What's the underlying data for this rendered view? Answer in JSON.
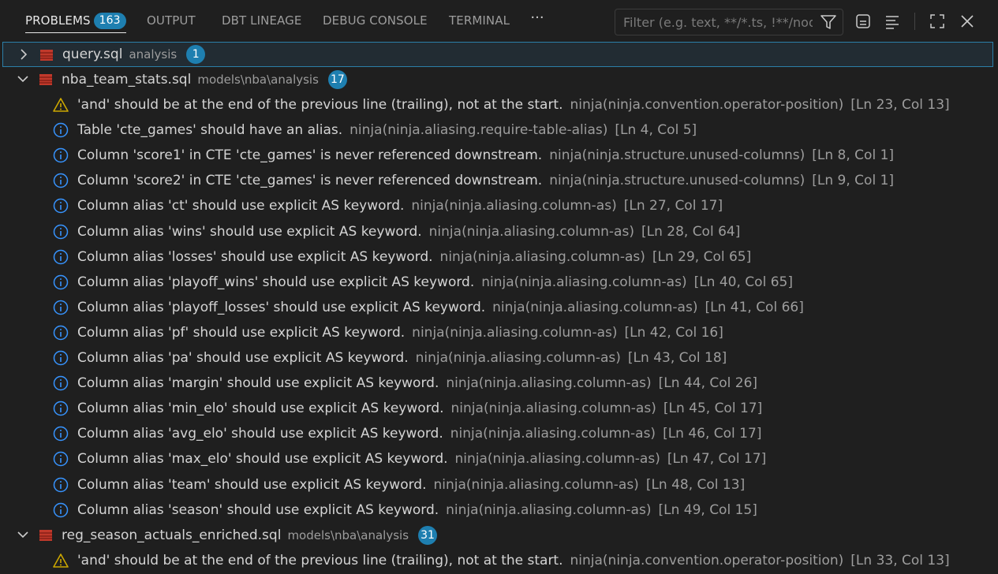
{
  "tabs": [
    {
      "label": "PROBLEMS",
      "badge": "163"
    },
    {
      "label": "OUTPUT"
    },
    {
      "label": "DBT LINEAGE"
    },
    {
      "label": "DEBUG CONSOLE"
    },
    {
      "label": "TERMINAL"
    }
  ],
  "more_label": "···",
  "filter": {
    "placeholder": "Filter (e.g. text, **/*.ts, !**/nod..."
  },
  "files": [
    {
      "name": "query.sql",
      "path": "analysis",
      "count": "1",
      "expanded": false
    },
    {
      "name": "nba_team_stats.sql",
      "path": "models\\nba\\analysis",
      "count": "17",
      "expanded": true
    },
    {
      "name": "reg_season_actuals_enriched.sql",
      "path": "models\\nba\\analysis",
      "count": "31",
      "expanded": true
    }
  ],
  "problems": [
    {
      "severity": "warning",
      "message": "'and' should be at the end of the previous line (trailing), not at the start.",
      "source": "ninja(ninja.convention.operator-position)",
      "location": "[Ln 23, Col 13]"
    },
    {
      "severity": "info",
      "message": "Table 'cte_games' should have an alias.",
      "source": "ninja(ninja.aliasing.require-table-alias)",
      "location": "[Ln 4, Col 5]"
    },
    {
      "severity": "info",
      "message": "Column 'score1' in CTE 'cte_games' is never referenced downstream.",
      "source": "ninja(ninja.structure.unused-columns)",
      "location": "[Ln 8, Col 1]"
    },
    {
      "severity": "info",
      "message": "Column 'score2' in CTE 'cte_games' is never referenced downstream.",
      "source": "ninja(ninja.structure.unused-columns)",
      "location": "[Ln 9, Col 1]"
    },
    {
      "severity": "info",
      "message": "Column alias 'ct' should use explicit AS keyword.",
      "source": "ninja(ninja.aliasing.column-as)",
      "location": "[Ln 27, Col 17]"
    },
    {
      "severity": "info",
      "message": "Column alias 'wins' should use explicit AS keyword.",
      "source": "ninja(ninja.aliasing.column-as)",
      "location": "[Ln 28, Col 64]"
    },
    {
      "severity": "info",
      "message": "Column alias 'losses' should use explicit AS keyword.",
      "source": "ninja(ninja.aliasing.column-as)",
      "location": "[Ln 29, Col 65]"
    },
    {
      "severity": "info",
      "message": "Column alias 'playoff_wins' should use explicit AS keyword.",
      "source": "ninja(ninja.aliasing.column-as)",
      "location": "[Ln 40, Col 65]"
    },
    {
      "severity": "info",
      "message": "Column alias 'playoff_losses' should use explicit AS keyword.",
      "source": "ninja(ninja.aliasing.column-as)",
      "location": "[Ln 41, Col 66]"
    },
    {
      "severity": "info",
      "message": "Column alias 'pf' should use explicit AS keyword.",
      "source": "ninja(ninja.aliasing.column-as)",
      "location": "[Ln 42, Col 16]"
    },
    {
      "severity": "info",
      "message": "Column alias 'pa' should use explicit AS keyword.",
      "source": "ninja(ninja.aliasing.column-as)",
      "location": "[Ln 43, Col 18]"
    },
    {
      "severity": "info",
      "message": "Column alias 'margin' should use explicit AS keyword.",
      "source": "ninja(ninja.aliasing.column-as)",
      "location": "[Ln 44, Col 26]"
    },
    {
      "severity": "info",
      "message": "Column alias 'min_elo' should use explicit AS keyword.",
      "source": "ninja(ninja.aliasing.column-as)",
      "location": "[Ln 45, Col 17]"
    },
    {
      "severity": "info",
      "message": "Column alias 'avg_elo' should use explicit AS keyword.",
      "source": "ninja(ninja.aliasing.column-as)",
      "location": "[Ln 46, Col 17]"
    },
    {
      "severity": "info",
      "message": "Column alias 'max_elo' should use explicit AS keyword.",
      "source": "ninja(ninja.aliasing.column-as)",
      "location": "[Ln 47, Col 17]"
    },
    {
      "severity": "info",
      "message": "Column alias 'team' should use explicit AS keyword.",
      "source": "ninja(ninja.aliasing.column-as)",
      "location": "[Ln 48, Col 13]"
    },
    {
      "severity": "info",
      "message": "Column alias 'season' should use explicit AS keyword.",
      "source": "ninja(ninja.aliasing.column-as)",
      "location": "[Ln 49, Col 15]"
    },
    {
      "severity": "warning",
      "message": "'and' should be at the end of the previous line (trailing), not at the start.",
      "source": "ninja(ninja.convention.operator-position)",
      "location": "[Ln 33, Col 13]"
    }
  ],
  "colors": {
    "accent": "#1e7fb0",
    "warning": "#cca700",
    "info": "#3794ff",
    "file_icon": "#c0392b"
  }
}
